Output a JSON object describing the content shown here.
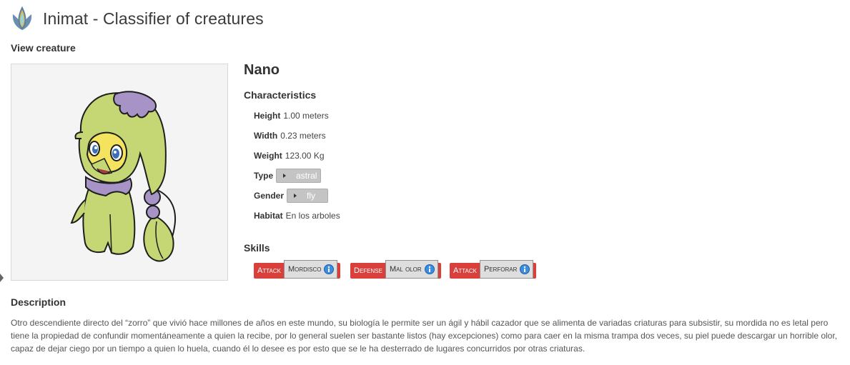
{
  "header": {
    "title": "Inimat - Classifier of creatures",
    "logo_icon": "drop-leaf-logo-icon"
  },
  "page": {
    "subtitle": "View creature"
  },
  "creature": {
    "name": "Nano",
    "characteristics_heading": "Characteristics",
    "height": {
      "label": "Height",
      "value": "1.00 meters"
    },
    "width": {
      "label": "Width",
      "value": "0.23 meters"
    },
    "weight": {
      "label": "Weight",
      "value": "123.00 Kg"
    },
    "type": {
      "label": "Type",
      "selected": "astral"
    },
    "gender": {
      "label": "Gender",
      "selected": "fly"
    },
    "habitat": {
      "label": "Habitat",
      "value": "En los arboles"
    },
    "skills_heading": "Skills",
    "skills": [
      {
        "kind": "Attack",
        "name": "Mordisco"
      },
      {
        "kind": "Defense",
        "name": "Mal olor"
      },
      {
        "kind": "Attack",
        "name": "Perforar"
      }
    ]
  },
  "description": {
    "heading": "Description",
    "text": "Otro descendiente directo del “zorro” que vivió hace millones de años en este mundo, su biología le permite ser un ágil y hábil cazador que se alimenta de variadas criaturas para subsistir, su mordida no es letal pero tiene la propiedad de confundir momentáneamente a quien la recibe, por lo general suelen ser bastante listos (hay excepciones) como para caer en la misma trampa dos veces, su piel puede descargar un horrible olor, capaz de dejar ciego por un tiempo a quien lo huela, cuando él lo desee es por esto que se le ha desterrado de lugares concurridos por otras criaturas."
  },
  "colors": {
    "skill_red": "#d9403b",
    "dropdown_gray": "#c4c4c4",
    "creature_green": "#c5d774",
    "creature_purple": "#a793c6"
  }
}
